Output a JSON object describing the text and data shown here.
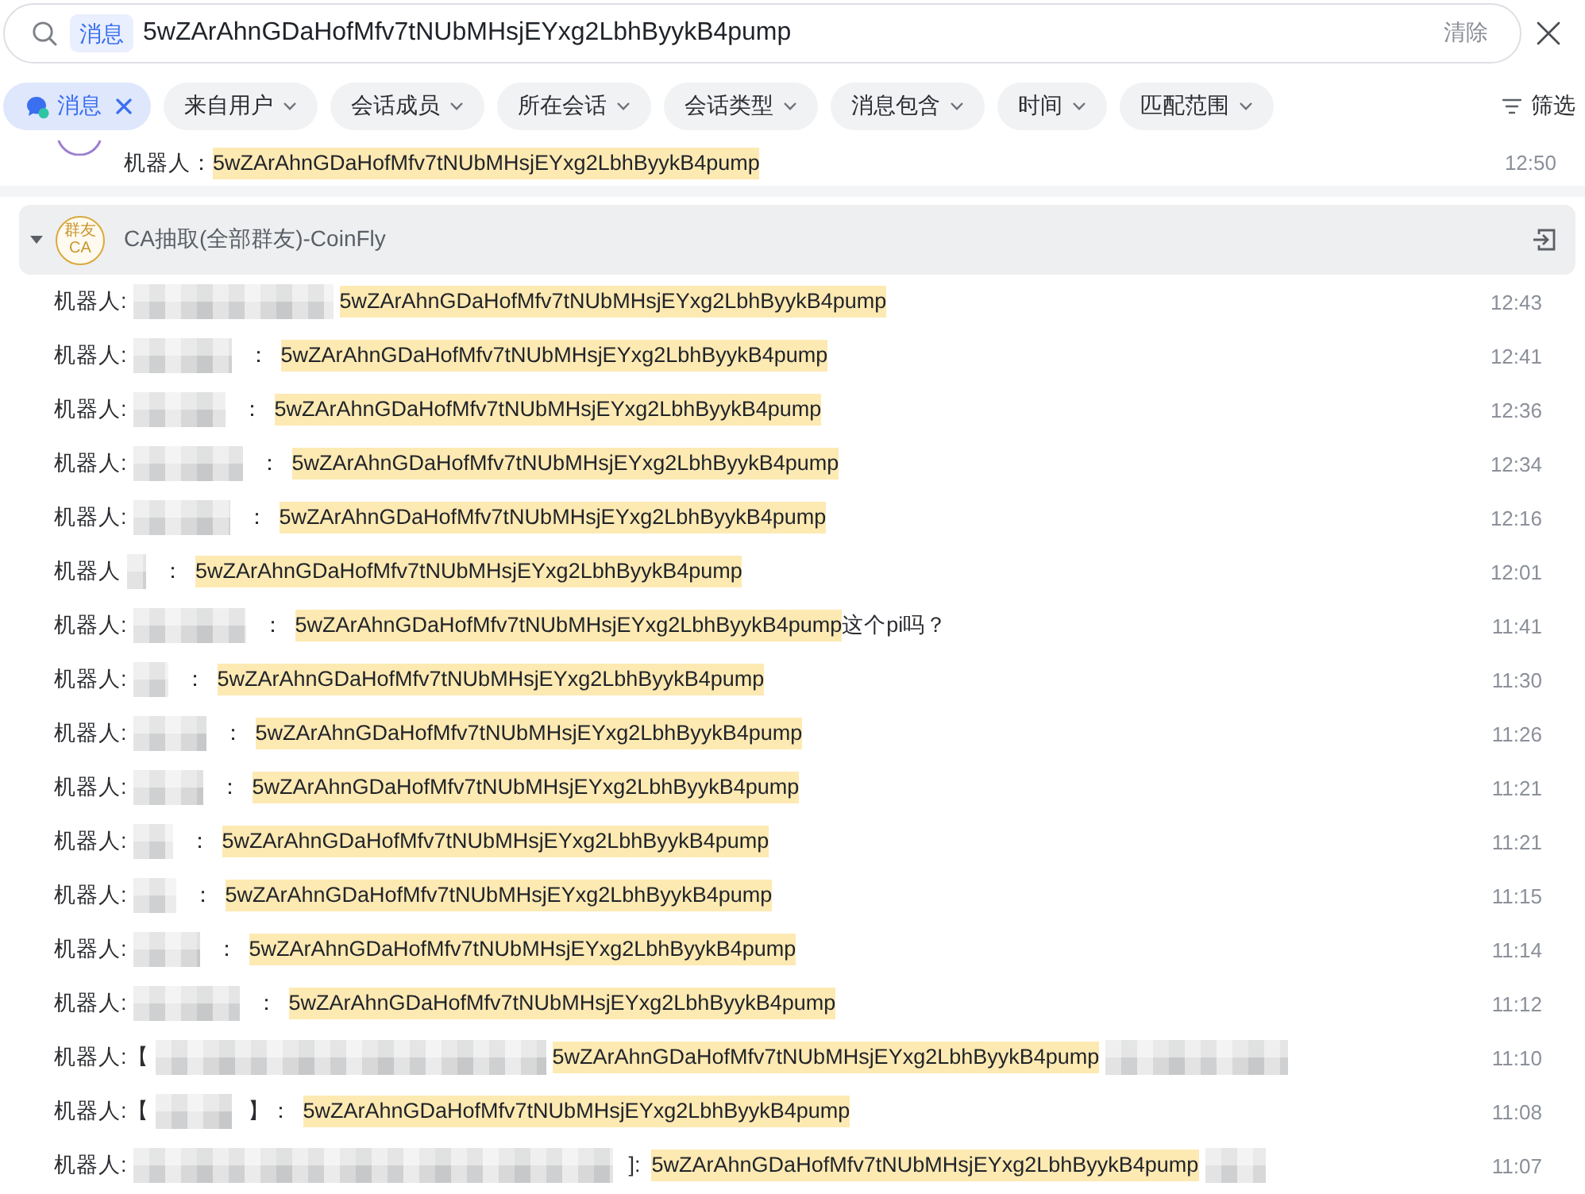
{
  "search": {
    "scope": "消息",
    "value": "5wZArAhnGDaHofMfv7tNUbMHsjEYxg2LbhByykB4pump",
    "clear_label": "清除"
  },
  "filters": [
    {
      "label": "消息",
      "selected": true
    },
    {
      "label": "来自用户",
      "selected": false
    },
    {
      "label": "会话成员",
      "selected": false
    },
    {
      "label": "所在会话",
      "selected": false
    },
    {
      "label": "会话类型",
      "selected": false
    },
    {
      "label": "消息包含",
      "selected": false
    },
    {
      "label": "时间",
      "selected": false
    },
    {
      "label": "匹配范围",
      "selected": false
    }
  ],
  "filter_button": "筛选",
  "previous_result": {
    "parts": [
      {
        "kind": "label",
        "text": "机器人："
      },
      {
        "kind": "match",
        "text": "5wZArAhnGDaHofMfv7tNUbMHsjEYxg2LbhByykB4pump"
      }
    ],
    "time": "12:50"
  },
  "groups": [
    {
      "avatar_text": [
        "群友",
        "CA"
      ],
      "title": "CA抽取(全部群友)-CoinFly",
      "expanded": true,
      "messages": [
        {
          "parts": [
            {
              "kind": "label",
              "text": "机器人:"
            },
            {
              "kind": "blur"
            },
            {
              "kind": "match",
              "text": "5wZArAhnGDaHofMfv7tNUbMHsjEYxg2LbhByykB4pump"
            }
          ],
          "time": "12:43"
        },
        {
          "parts": [
            {
              "kind": "label",
              "text": "机器人:"
            },
            {
              "kind": "blur"
            },
            {
              "kind": "separator",
              "text": "："
            },
            {
              "kind": "match",
              "text": "5wZArAhnGDaHofMfv7tNUbMHsjEYxg2LbhByykB4pump"
            }
          ],
          "time": "12:41"
        },
        {
          "parts": [
            {
              "kind": "label",
              "text": "机器人:"
            },
            {
              "kind": "blur"
            },
            {
              "kind": "separator",
              "text": "："
            },
            {
              "kind": "match",
              "text": "5wZArAhnGDaHofMfv7tNUbMHsjEYxg2LbhByykB4pump"
            }
          ],
          "time": "12:36"
        },
        {
          "parts": [
            {
              "kind": "label",
              "text": "机器人:"
            },
            {
              "kind": "blur"
            },
            {
              "kind": "separator",
              "text": "："
            },
            {
              "kind": "match",
              "text": "5wZArAhnGDaHofMfv7tNUbMHsjEYxg2LbhByykB4pump"
            }
          ],
          "time": "12:34"
        },
        {
          "parts": [
            {
              "kind": "label",
              "text": "机器人:"
            },
            {
              "kind": "blur"
            },
            {
              "kind": "separator",
              "text": "："
            },
            {
              "kind": "match",
              "text": "5wZArAhnGDaHofMfv7tNUbMHsjEYxg2LbhByykB4pump"
            }
          ],
          "time": "12:16"
        },
        {
          "parts": [
            {
              "kind": "label",
              "text": "机器人"
            },
            {
              "kind": "blur"
            },
            {
              "kind": "separator",
              "text": "："
            },
            {
              "kind": "match",
              "text": "5wZArAhnGDaHofMfv7tNUbMHsjEYxg2LbhByykB4pump"
            }
          ],
          "time": "12:01"
        },
        {
          "parts": [
            {
              "kind": "label",
              "text": "机器人:"
            },
            {
              "kind": "blur"
            },
            {
              "kind": "separator",
              "text": "："
            },
            {
              "kind": "match",
              "text": "5wZArAhnGDaHofMfv7tNUbMHsjEYxg2LbhByykB4pump"
            },
            {
              "kind": "text",
              "text": "这个pi吗？"
            }
          ],
          "time": "11:41"
        },
        {
          "parts": [
            {
              "kind": "label",
              "text": "机器人:"
            },
            {
              "kind": "blur"
            },
            {
              "kind": "separator",
              "text": "："
            },
            {
              "kind": "match",
              "text": "5wZArAhnGDaHofMfv7tNUbMHsjEYxg2LbhByykB4pump"
            }
          ],
          "time": "11:30"
        },
        {
          "parts": [
            {
              "kind": "label",
              "text": "机器人:"
            },
            {
              "kind": "blur"
            },
            {
              "kind": "separator",
              "text": "："
            },
            {
              "kind": "match",
              "text": "5wZArAhnGDaHofMfv7tNUbMHsjEYxg2LbhByykB4pump"
            }
          ],
          "time": "11:26"
        },
        {
          "parts": [
            {
              "kind": "label",
              "text": "机器人:"
            },
            {
              "kind": "blur"
            },
            {
              "kind": "separator",
              "text": "："
            },
            {
              "kind": "match",
              "text": "5wZArAhnGDaHofMfv7tNUbMHsjEYxg2LbhByykB4pump"
            }
          ],
          "time": "11:21"
        },
        {
          "parts": [
            {
              "kind": "label",
              "text": "机器人:"
            },
            {
              "kind": "blur"
            },
            {
              "kind": "separator",
              "text": "："
            },
            {
              "kind": "match",
              "text": "5wZArAhnGDaHofMfv7tNUbMHsjEYxg2LbhByykB4pump"
            }
          ],
          "time": "11:21"
        },
        {
          "parts": [
            {
              "kind": "label",
              "text": "机器人:"
            },
            {
              "kind": "blur"
            },
            {
              "kind": "separator",
              "text": "："
            },
            {
              "kind": "match",
              "text": "5wZArAhnGDaHofMfv7tNUbMHsjEYxg2LbhByykB4pump"
            }
          ],
          "time": "11:15"
        },
        {
          "parts": [
            {
              "kind": "label",
              "text": "机器人:"
            },
            {
              "kind": "blur"
            },
            {
              "kind": "separator",
              "text": "："
            },
            {
              "kind": "match",
              "text": "5wZArAhnGDaHofMfv7tNUbMHsjEYxg2LbhByykB4pump"
            }
          ],
          "time": "11:14"
        },
        {
          "parts": [
            {
              "kind": "label",
              "text": "机器人:"
            },
            {
              "kind": "blur"
            },
            {
              "kind": "separator",
              "text": "："
            },
            {
              "kind": "match",
              "text": "5wZArAhnGDaHofMfv7tNUbMHsjEYxg2LbhByykB4pump"
            }
          ],
          "time": "11:12"
        },
        {
          "parts": [
            {
              "kind": "label",
              "text": "机器人:【"
            },
            {
              "kind": "blur"
            },
            {
              "kind": "match",
              "text": "5wZArAhnGDaHofMfv7tNUbMHsjEYxg2LbhByykB4pump"
            },
            {
              "kind": "blur"
            }
          ],
          "time": "11:10"
        },
        {
          "parts": [
            {
              "kind": "label",
              "text": "机器人:【"
            },
            {
              "kind": "blur"
            },
            {
              "kind": "separator",
              "text": "】："
            },
            {
              "kind": "match",
              "text": "5wZArAhnGDaHofMfv7tNUbMHsjEYxg2LbhByykB4pump"
            }
          ],
          "time": "11:08"
        },
        {
          "parts": [
            {
              "kind": "label",
              "text": "机器人:"
            },
            {
              "kind": "blur"
            },
            {
              "kind": "separator",
              "text": "]:"
            },
            {
              "kind": "match",
              "text": "5wZArAhnGDaHofMfv7tNUbMHsjEYxg2LbhByykB4pump"
            },
            {
              "kind": "blur"
            }
          ],
          "time": "11:07"
        }
      ]
    }
  ]
}
